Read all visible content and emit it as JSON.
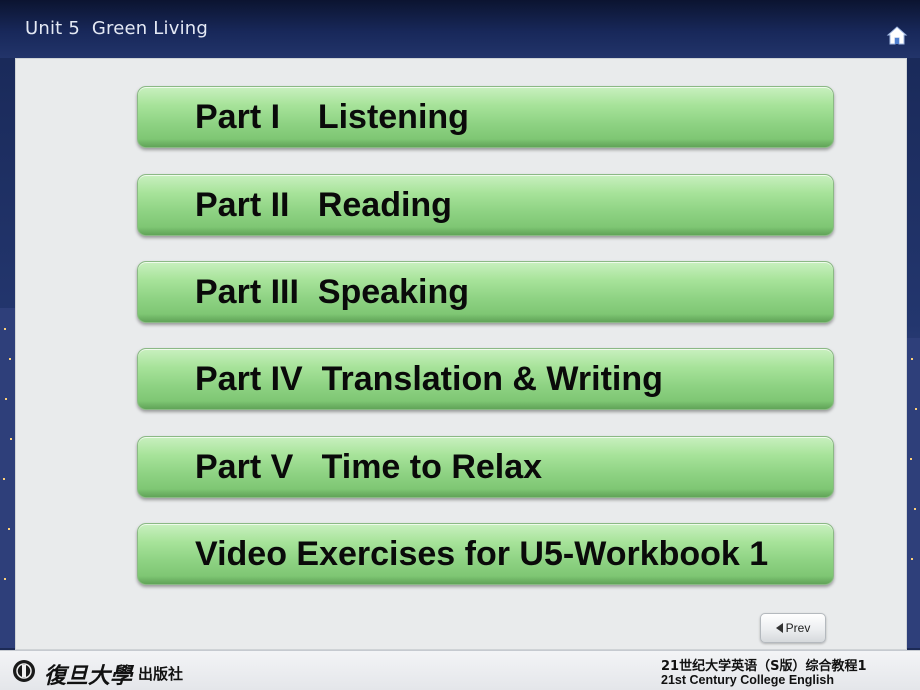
{
  "header": {
    "unit_title": "Unit 5  Green Living"
  },
  "icons": {
    "home": "home-icon",
    "prev": "triangle-left-icon",
    "publisher": "publisher-logo-icon"
  },
  "menu": {
    "items": [
      {
        "label": "Part I    Listening"
      },
      {
        "label": "Part II   Reading"
      },
      {
        "label": "Part III  Speaking"
      },
      {
        "label": "Part IV  Translation & Writing"
      },
      {
        "label": "Part V   Time to Relax"
      },
      {
        "label": "Video Exercises for U5-Workbook 1"
      }
    ]
  },
  "nav": {
    "prev_label": "Prev"
  },
  "footer": {
    "publisher_name": "復旦大學",
    "publisher_suffix": "出版社",
    "course_cn": "21世纪大学英语（S版）综合教程1",
    "course_en": "21st Century College English"
  },
  "colors": {
    "button_green": "#8fd384",
    "panel_bg": "#e9ebec",
    "header_bg": "#18285a"
  }
}
